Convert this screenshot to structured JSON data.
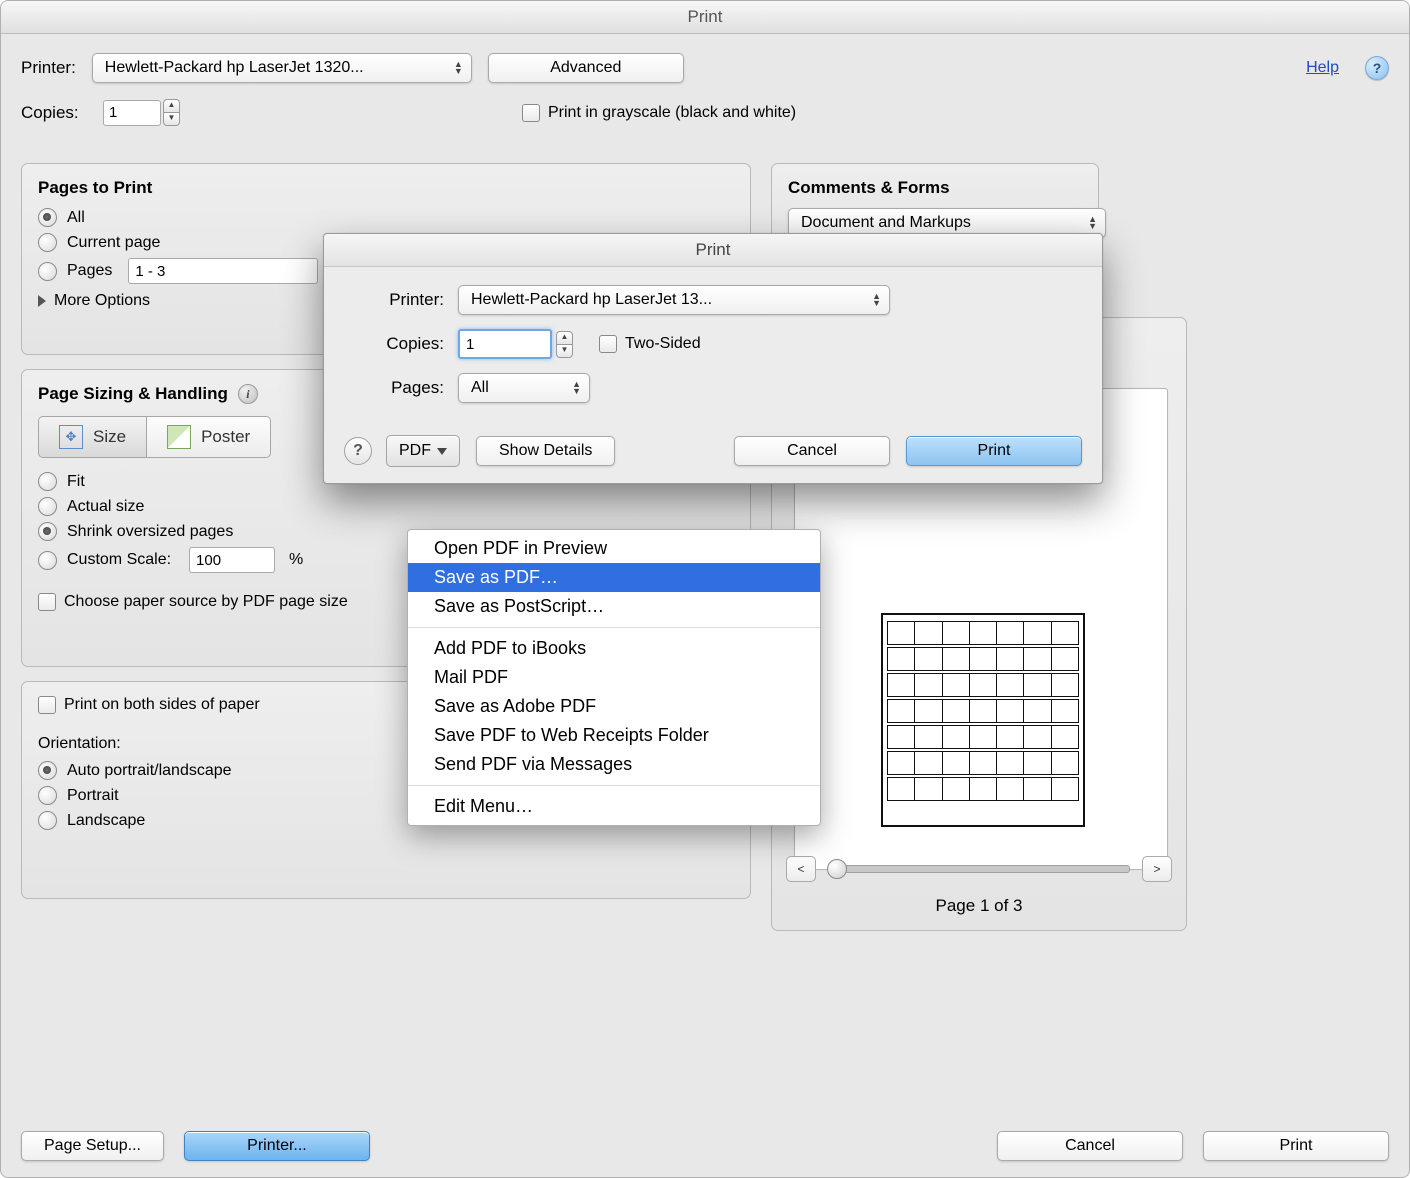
{
  "window": {
    "title": "Print"
  },
  "top": {
    "printer_label": "Printer:",
    "printer_value": "Hewlett-Packard hp LaserJet 1320...",
    "advanced": "Advanced",
    "help": "Help",
    "copies_label": "Copies:",
    "copies_value": "1",
    "grayscale": "Print in grayscale (black and white)"
  },
  "pages": {
    "title": "Pages to Print",
    "all": "All",
    "current": "Current page",
    "pages_label": "Pages",
    "pages_value": "1 - 3",
    "more": "More Options"
  },
  "comments": {
    "title": "Comments & Forms",
    "value": "Document and Markups"
  },
  "sizing": {
    "title": "Page Sizing & Handling",
    "size": "Size",
    "poster": "Poster",
    "fit": "Fit",
    "actual": "Actual size",
    "shrink": "Shrink oversized pages",
    "custom": "Custom Scale:",
    "custom_value": "100",
    "percent": "%",
    "paper_source": "Choose paper source by PDF page size"
  },
  "duplex": {
    "both_sides": "Print on both sides of paper",
    "orientation": "Orientation:",
    "auto": "Auto portrait/landscape",
    "portrait": "Portrait",
    "landscape": "Landscape"
  },
  "preview": {
    "prev": "<",
    "next": ">",
    "page_of": "Page 1 of 3"
  },
  "footer": {
    "page_setup": "Page Setup...",
    "printer_btn": "Printer...",
    "cancel": "Cancel",
    "print": "Print"
  },
  "sheet": {
    "title": "Print",
    "printer_label": "Printer:",
    "printer_value": "Hewlett-Packard hp LaserJet 13...",
    "copies_label": "Copies:",
    "copies_value": "1",
    "two_sided": "Two-Sided",
    "pages_label": "Pages:",
    "pages_value": "All",
    "pdf_btn": "PDF",
    "show_details": "Show Details",
    "cancel": "Cancel",
    "print": "Print"
  },
  "pdf_menu": {
    "open": "Open PDF in Preview",
    "save": "Save as PDF…",
    "postscript": "Save as PostScript…",
    "ibooks": "Add PDF to iBooks",
    "mail": "Mail PDF",
    "adobe": "Save as Adobe PDF",
    "receipts": "Save PDF to Web Receipts Folder",
    "messages": "Send PDF via Messages",
    "edit": "Edit Menu…"
  }
}
